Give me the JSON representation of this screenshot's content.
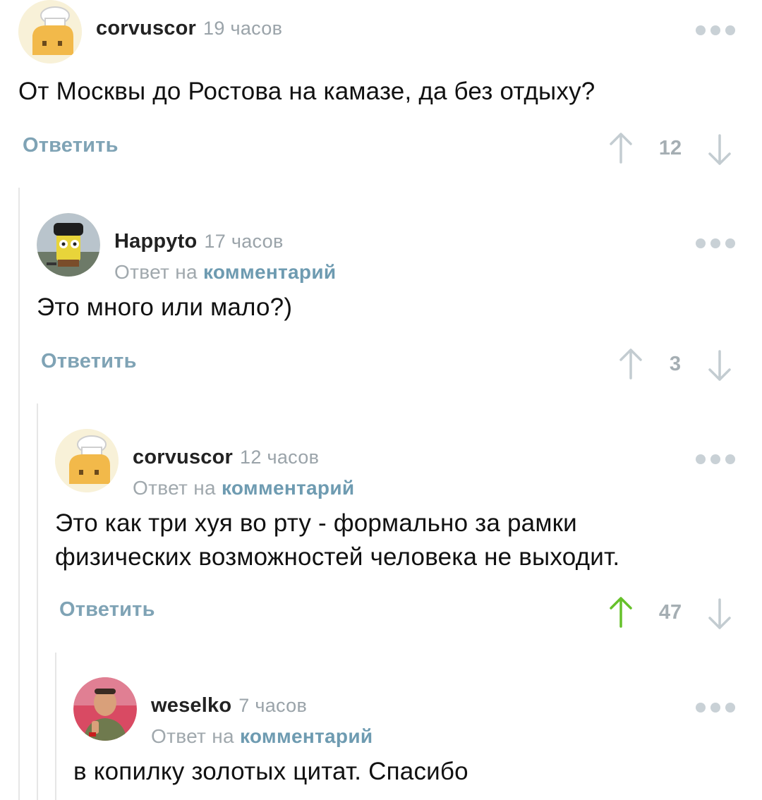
{
  "colors": {
    "accent_link": "#6e9bb1",
    "reply_button": "#7fa3b5",
    "meta_grey": "#9aa3a9",
    "upvoted": "#66c12a",
    "arrow_grey": "#c3ccd1"
  },
  "comments": [
    {
      "author": "corvuscor",
      "time": "19 часов",
      "reply_to_prefix": "",
      "reply_to_link": "",
      "text": "От Москвы до Ростова на камазе, да без отдыху?",
      "reply_label": "Ответить",
      "rating": "12",
      "upvoted": false,
      "avatar_icon": "toast-chef-avatar"
    },
    {
      "author": "Happyto",
      "time": "17 часов",
      "reply_to_prefix": "Ответ на",
      "reply_to_link": "комментарий",
      "text": "Это много или мало?)",
      "reply_label": "Ответить",
      "rating": "3",
      "upvoted": false,
      "avatar_icon": "sponge-character-avatar"
    },
    {
      "author": "corvuscor",
      "time": "12 часов",
      "reply_to_prefix": "Ответ на",
      "reply_to_link": "комментарий",
      "text_lines": [
        "Это как три хуя во рту - формально за рамки",
        "физических возможностей человека не выходит."
      ],
      "reply_label": "Ответить",
      "rating": "47",
      "upvoted": true,
      "avatar_icon": "toast-chef-avatar"
    },
    {
      "author": "weselko",
      "time": "7 часов",
      "reply_to_prefix": "Ответ на",
      "reply_to_link": "комментарий",
      "text": "в копилку золотых цитат. Спасибо",
      "avatar_icon": "person-photo-avatar"
    }
  ]
}
